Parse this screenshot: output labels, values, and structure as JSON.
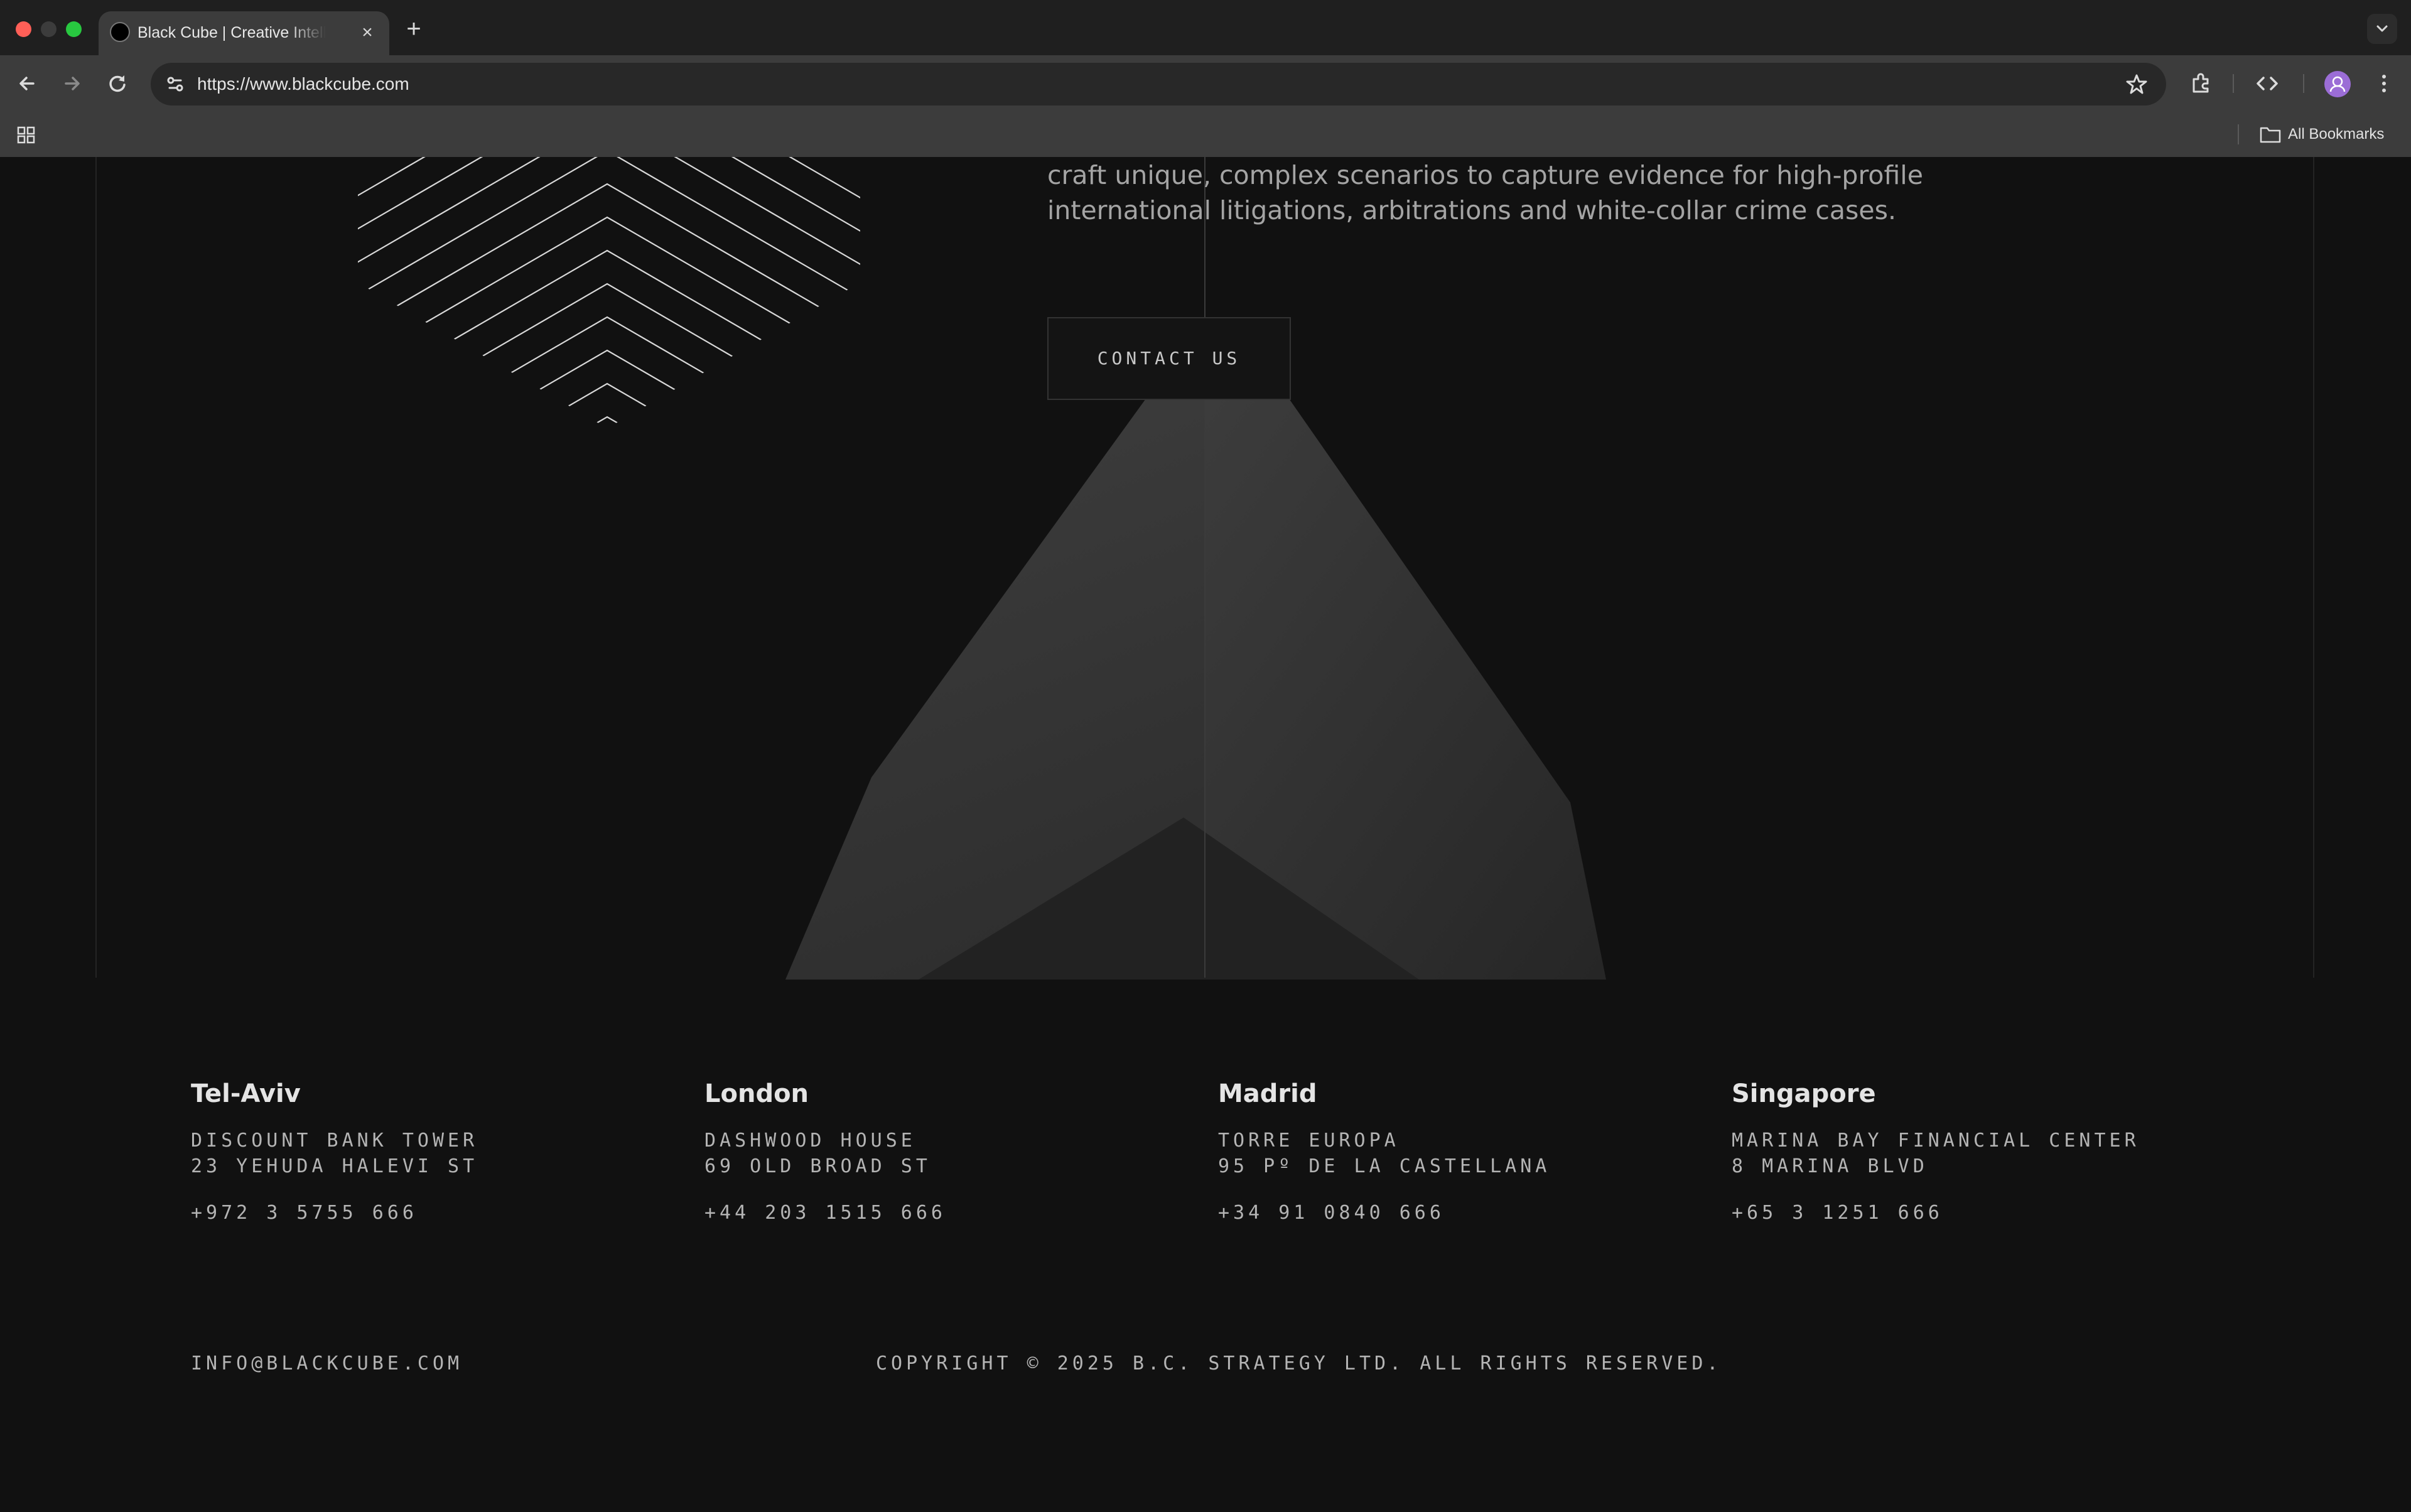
{
  "browser": {
    "tab_title": "Black Cube | Creative Intelligence",
    "tab_close_glyph": "×",
    "new_tab_glyph": "+",
    "url": "https://www.blackcube.com",
    "bookmarks_label": "All Bookmarks",
    "icons": [
      "back-icon",
      "forward-icon",
      "reload-icon",
      "site-info-icon",
      "bookmark-star-icon",
      "extensions-icon",
      "devtools-icon",
      "profile-avatar",
      "chrome-menu-icon",
      "apps-grid-icon",
      "folder-icon",
      "tab-search-icon"
    ]
  },
  "hero": {
    "intro": "diverse backgrounds, cultures, and languages. As social engineers, we craft unique, complex scenarios to capture evidence for high-profile international litigations, arbitrations and white-collar crime cases.",
    "contact_label": "CONTACT US"
  },
  "offices": [
    {
      "city": "Tel-Aviv",
      "address_line1": "DISCOUNT BANK TOWER",
      "address_line2": "23 YEHUDA HALEVI ST",
      "phone": "+972 3 5755 666"
    },
    {
      "city": "London",
      "address_line1": "DASHWOOD HOUSE",
      "address_line2": "69 OLD BROAD ST",
      "phone": "+44 203 1515 666"
    },
    {
      "city": "Madrid",
      "address_line1": "TORRE EUROPA",
      "address_line2": "95 Pº DE LA CASTELLANA",
      "phone": "+34 91 0840 666"
    },
    {
      "city": "Singapore",
      "address_line1": "MARINA BAY FINANCIAL CENTER",
      "address_line2": "8 MARINA BLVD",
      "phone": "+65 3 1251 666"
    }
  ],
  "footer": {
    "email": "INFO@BLACKCUBE.COM",
    "copyright": "COPYRIGHT © 2025 B.C. STRATEGY LTD. ALL RIGHTS RESERVED."
  },
  "colors": {
    "page_background": "#111111",
    "chrome_background": "#3c3c3c",
    "tabstrip_background": "#1f1f1f",
    "text_primary": "#e4e4e4",
    "text_secondary": "#b4b4b4",
    "profile_accent": "#9b6dd6"
  }
}
